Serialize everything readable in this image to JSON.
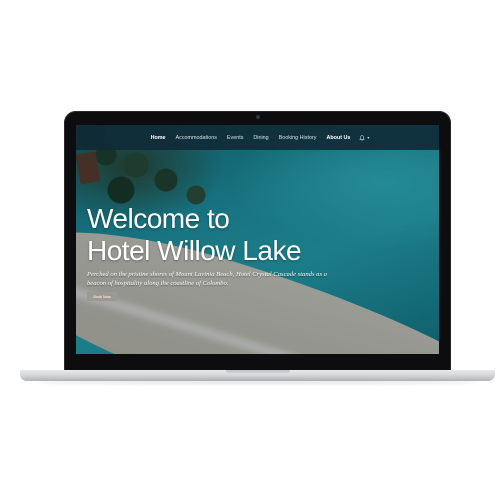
{
  "nav": {
    "items": [
      {
        "label": "Home",
        "bold": true
      },
      {
        "label": "Accommodations",
        "bold": false
      },
      {
        "label": "Events",
        "bold": false
      },
      {
        "label": "Dining",
        "bold": false
      },
      {
        "label": "Booking History",
        "bold": false
      },
      {
        "label": "About Us",
        "bold": true
      }
    ],
    "notification_icon": "bell-icon"
  },
  "hero": {
    "title_line1": "Welcome to",
    "title_line2": "Hotel Willow Lake",
    "description": "Perched on the pristine shores of Mount Lavinia Beach, Hotel Crystal Cascade stands as a beacon of hospitality along the coastline of Colombo.",
    "button_label": "Book Now"
  },
  "colors": {
    "nav_background": "#0f2a37",
    "button_background": "#9d9891",
    "sea": "#1e9aa8",
    "sand": "#d8d2c6"
  }
}
